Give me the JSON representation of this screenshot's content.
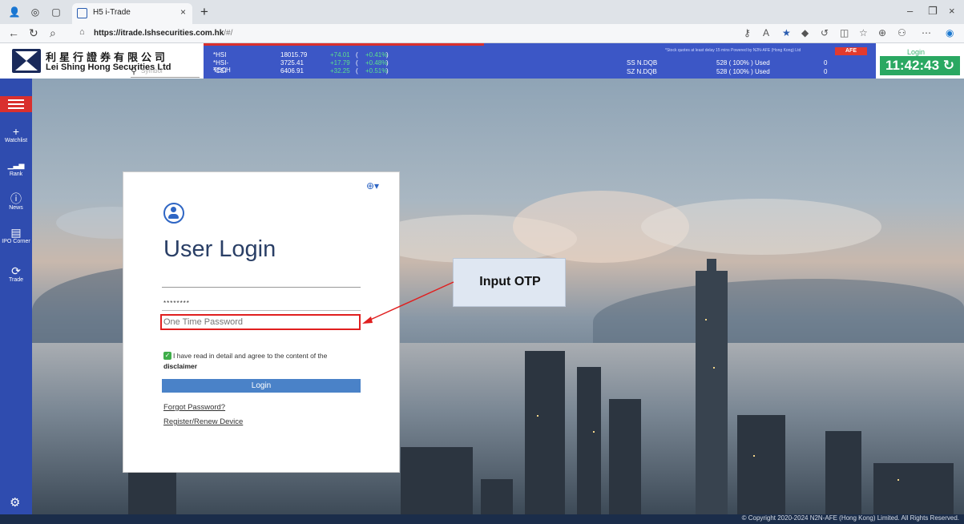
{
  "browser": {
    "tab_title": "H5 i-Trade",
    "tab_close": "×",
    "new_tab": "+",
    "url_host": "https://itrade.lshsecurities.com.hk",
    "url_path": "/#/",
    "win_min": "–",
    "win_max": "❐",
    "win_close": "×"
  },
  "header": {
    "company_zh": "利星行證券有限公司",
    "company_en": "Lei Shing Hong Securities Ltd",
    "symbol_placeholder": "Symbol",
    "quotes": [
      {
        "name": "*HSI",
        "value": "18015.79",
        "change": "+74.01",
        "pct": "+0.41%"
      },
      {
        "name": "*HSI-TECH",
        "value": "3725.41",
        "change": "+17.79",
        "pct": "+0.48%"
      },
      {
        "name": "*CEI",
        "value": "6406.91",
        "change": "+32.25",
        "pct": "+0.51%"
      }
    ],
    "quote_open": "(",
    "quote_close": ")",
    "connect": [
      {
        "name": "SS N.DQB",
        "used": "528 (   100%   ) Used",
        "count": "0"
      },
      {
        "name": "SZ N.DQB",
        "used": "528 (   100%   ) Used",
        "count": "0"
      }
    ],
    "quote_note": "*Stock quotes at least delay 15 mins    Powered by N2N-AFE (Hong Kong) Ltd",
    "afe_logo": "AFE",
    "login_link": "Login",
    "clock": "11:42:43 ↻"
  },
  "sidebar": {
    "items": [
      {
        "icon": "+",
        "label": "Watchlist"
      },
      {
        "icon": "▁▃▅",
        "label": "Rank"
      },
      {
        "icon": "ⓘ",
        "label": "News"
      },
      {
        "icon": "▤",
        "label": "IPO Corner"
      },
      {
        "icon": "⟳",
        "label": "Trade"
      }
    ],
    "settings_icon": "⚙"
  },
  "login": {
    "title": "User Login",
    "password_mask": "********",
    "otp_placeholder": "One Time Password",
    "agree_text": "I have read in detail and agree to the content of the",
    "disclaimer": "disclaimer",
    "login_button": "Login",
    "forgot_password": "Forgot Password?",
    "register": "Register/Renew Device"
  },
  "annotation": {
    "callout": "Input OTP"
  },
  "footer": {
    "copyright": "© Copyright 2020-2024 N2N-AFE (Hong Kong) Limited. All Rights Reserved."
  },
  "colors": {
    "header_blue": "#3c57c6",
    "sidebar_blue": "#2f4caf",
    "accent_red": "#d9302e",
    "clock_green": "#2aa862",
    "login_button": "#4a82c8",
    "otp_highlight": "#e01f1f"
  }
}
